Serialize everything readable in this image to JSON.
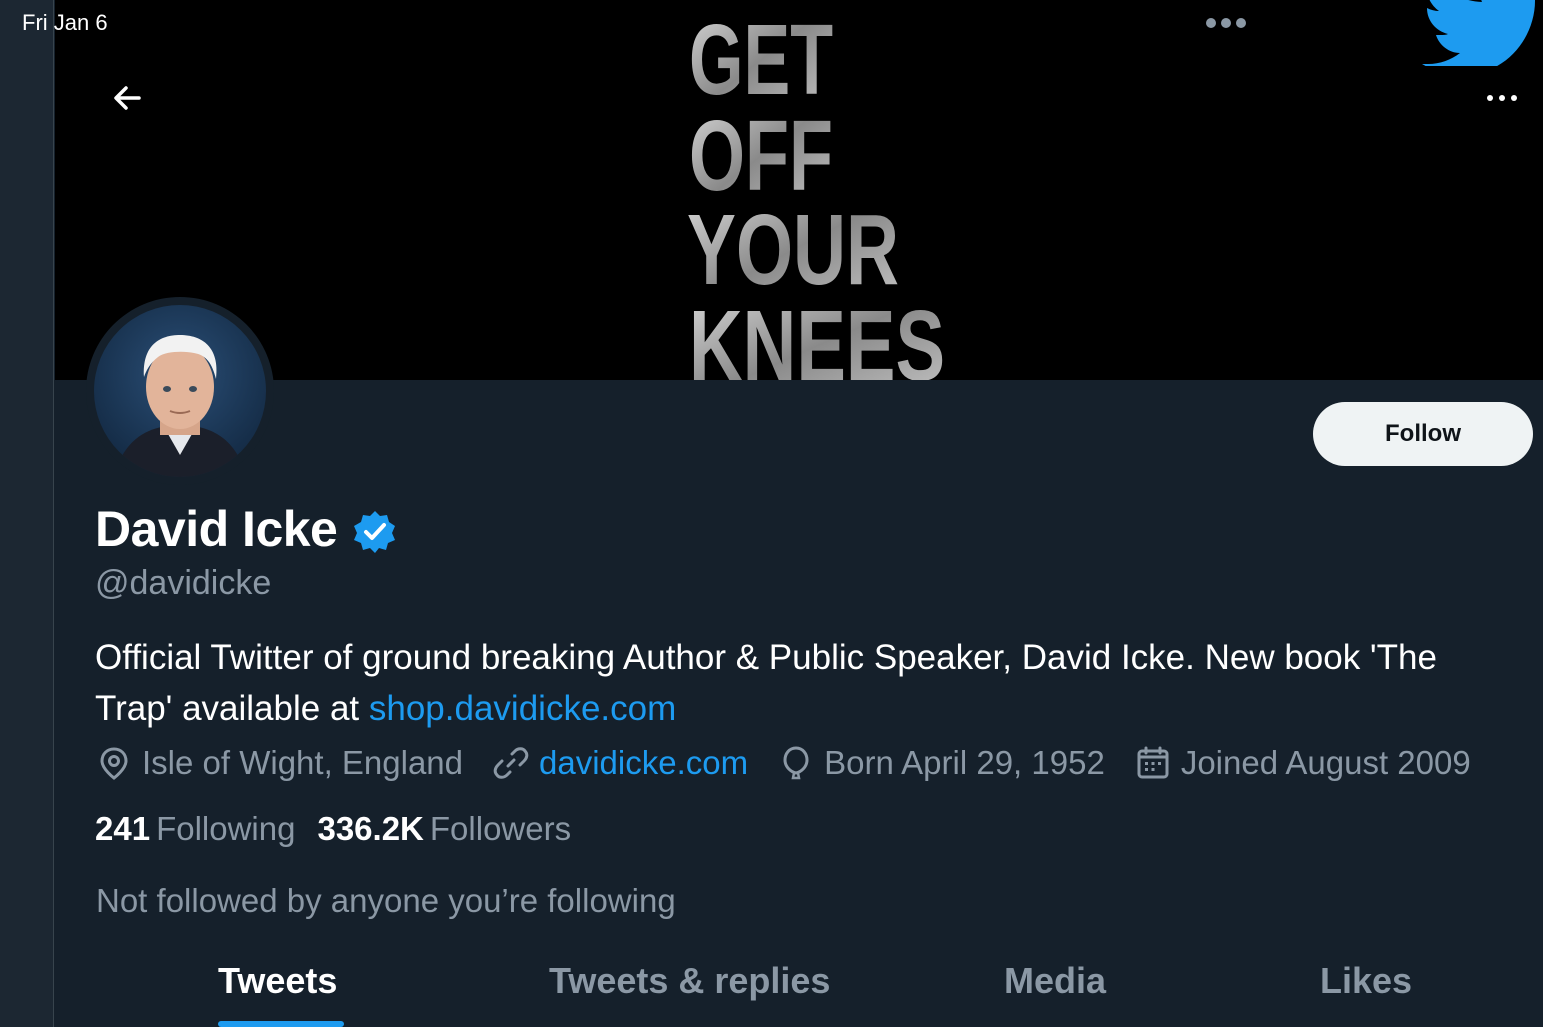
{
  "status_bar": {
    "date": "Fri Jan 6"
  },
  "banner": {
    "text_lines": [
      "GET",
      "OFF",
      "YOUR",
      "KNEES"
    ]
  },
  "icons": {
    "back": "arrow-left-icon",
    "more": "more-horizontal-icon",
    "verified": "verified-badge-icon",
    "location": "location-pin-icon",
    "link": "link-icon",
    "birthday": "balloon-icon",
    "calendar": "calendar-icon",
    "brand": "twitter-bird-icon"
  },
  "profile": {
    "name": "David Icke",
    "handle": "@davidicke",
    "bio_text": "Official Twitter of ground breaking Author & Public Speaker, David Icke. New book 'The Trap' available at",
    "bio_link": "shop.davidicke.com",
    "location": "Isle of Wight, England",
    "website": "davidicke.com",
    "born": "Born April 29, 1952",
    "joined": "Joined August 2009",
    "following_count": "241",
    "following_label": "Following",
    "followers_count": "336.2K",
    "followers_label": "Followers",
    "not_followed_text": "Not followed by anyone you’re following"
  },
  "actions": {
    "follow_label": "Follow"
  },
  "tabs": [
    {
      "label": "Tweets",
      "active": true
    },
    {
      "label": "Tweets & replies",
      "active": false
    },
    {
      "label": "Media",
      "active": false
    },
    {
      "label": "Likes",
      "active": false
    }
  ],
  "colors": {
    "background": "#15202b",
    "accent": "#1d9bf0",
    "muted_text": "#8b98a5",
    "follow_button_bg": "#eff3f4"
  }
}
